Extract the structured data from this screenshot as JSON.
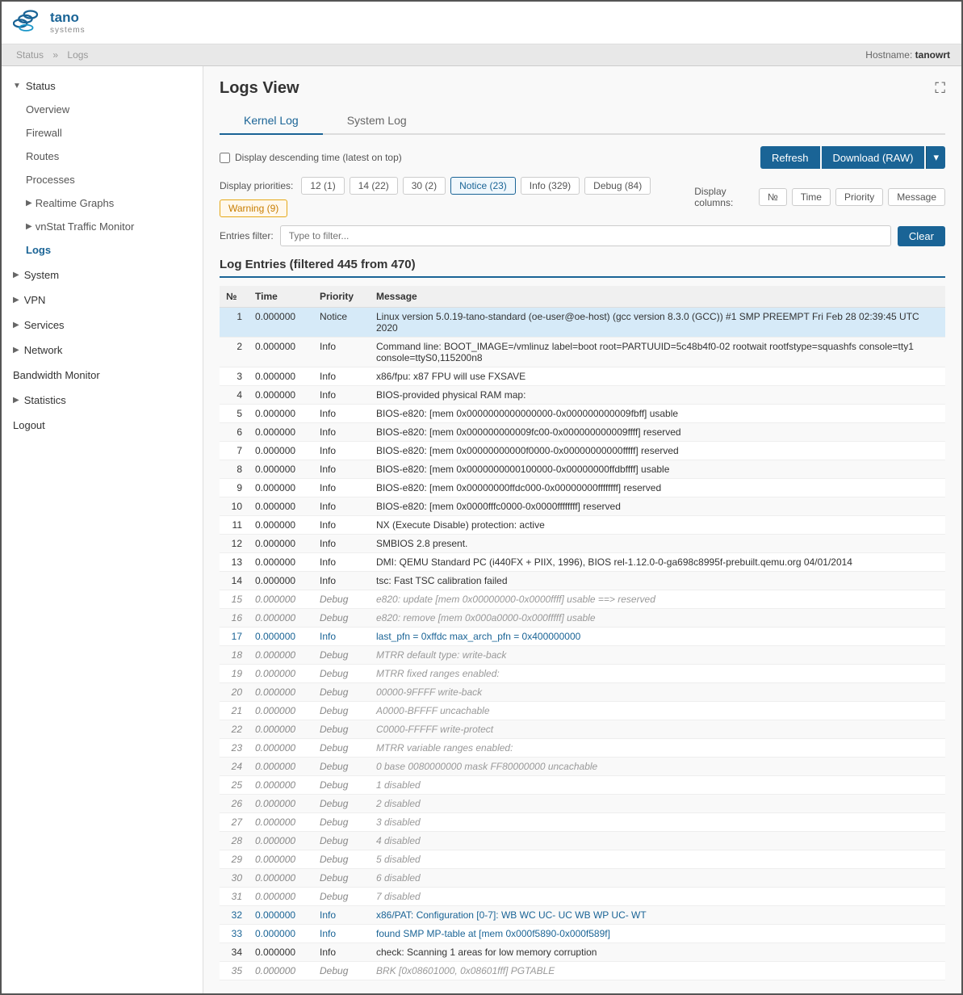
{
  "header": {
    "logo_tano": "tano",
    "logo_systems": "systems",
    "hostname_label": "Hostname:",
    "hostname_value": "tanowrt"
  },
  "breadcrumb": {
    "items": [
      "Status",
      "Logs"
    ]
  },
  "sidebar": {
    "sections": [
      {
        "label": "Status",
        "expanded": true,
        "items": [
          "Overview",
          "Firewall",
          "Routes",
          "Processes"
        ]
      }
    ],
    "collapsible_items": [
      {
        "label": "Realtime Graphs",
        "expandable": true
      },
      {
        "label": "vnStat Traffic Monitor",
        "expandable": true
      },
      {
        "label": "Logs",
        "active": true
      }
    ],
    "top_sections": [
      {
        "label": "System",
        "expandable": true
      },
      {
        "label": "VPN",
        "expandable": true
      },
      {
        "label": "Services",
        "expandable": true
      },
      {
        "label": "Network",
        "expandable": true
      },
      {
        "label": "Bandwidth Monitor",
        "expandable": false
      },
      {
        "label": "Statistics",
        "expandable": true
      },
      {
        "label": "Logout",
        "expandable": false
      }
    ]
  },
  "logs": {
    "title": "Logs View",
    "tabs": [
      {
        "label": "Kernel Log",
        "active": true
      },
      {
        "label": "System Log",
        "active": false
      }
    ],
    "checkbox_label": "Display descending time (latest on top)",
    "buttons": {
      "refresh": "Refresh",
      "download": "Download (RAW)",
      "dropdown_arrow": "▾"
    },
    "priorities_label": "Display priorities:",
    "priority_buttons": [
      {
        "label": "12 (1)",
        "type": "grey"
      },
      {
        "label": "14 (22)",
        "type": "grey"
      },
      {
        "label": "30 (2)",
        "type": "grey"
      },
      {
        "label": "Notice (23)",
        "type": "notice"
      },
      {
        "label": "Info (329)",
        "type": "info"
      },
      {
        "label": "Debug (84)",
        "type": "debug"
      },
      {
        "label": "Warning (9)",
        "type": "warning"
      }
    ],
    "columns_label": "Display columns:",
    "column_buttons": [
      "№",
      "Time",
      "Priority",
      "Message"
    ],
    "filter_label": "Entries filter:",
    "filter_placeholder": "Type to filter...",
    "clear_button": "Clear",
    "section_title": "Log Entries (filtered 445 from 470)",
    "table_headers": [
      "№",
      "Time",
      "Priority",
      "Message"
    ],
    "entries": [
      {
        "num": "1",
        "time": "0.000000",
        "priority": "Notice",
        "message": "Linux version 5.0.19-tano-standard (oe-user@oe-host) (gcc version 8.3.0 (GCC)) #1 SMP PREEMPT Fri Feb 28 02:39:45 UTC 2020",
        "style": "highlight"
      },
      {
        "num": "2",
        "time": "0.000000",
        "priority": "Info",
        "message": "Command line: BOOT_IMAGE=/vmlinuz label=boot root=PARTUUID=5c48b4f0-02 rootwait rootfstype=squashfs console=tty1 console=ttyS0,115200n8",
        "style": "normal"
      },
      {
        "num": "3",
        "time": "0.000000",
        "priority": "Info",
        "message": "x86/fpu: x87 FPU will use FXSAVE",
        "style": "normal"
      },
      {
        "num": "4",
        "time": "0.000000",
        "priority": "Info",
        "message": "BIOS-provided physical RAM map:",
        "style": "normal"
      },
      {
        "num": "5",
        "time": "0.000000",
        "priority": "Info",
        "message": "BIOS-e820: [mem 0x0000000000000000-0x000000000009fbff] usable",
        "style": "normal"
      },
      {
        "num": "6",
        "time": "0.000000",
        "priority": "Info",
        "message": "BIOS-e820: [mem 0x000000000009fc00-0x000000000009ffff] reserved",
        "style": "normal"
      },
      {
        "num": "7",
        "time": "0.000000",
        "priority": "Info",
        "message": "BIOS-e820: [mem 0x00000000000f0000-0x00000000000fffff] reserved",
        "style": "normal"
      },
      {
        "num": "8",
        "time": "0.000000",
        "priority": "Info",
        "message": "BIOS-e820: [mem 0x0000000000100000-0x00000000ffdbffff] usable",
        "style": "normal"
      },
      {
        "num": "9",
        "time": "0.000000",
        "priority": "Info",
        "message": "BIOS-e820: [mem 0x00000000ffdc000-0x00000000ffffffff] reserved",
        "style": "normal"
      },
      {
        "num": "10",
        "time": "0.000000",
        "priority": "Info",
        "message": "BIOS-e820: [mem 0x0000fffc0000-0x0000ffffffff] reserved",
        "style": "normal"
      },
      {
        "num": "11",
        "time": "0.000000",
        "priority": "Info",
        "message": "NX (Execute Disable) protection: active",
        "style": "normal"
      },
      {
        "num": "12",
        "time": "0.000000",
        "priority": "Info",
        "message": "SMBIOS 2.8 present.",
        "style": "normal"
      },
      {
        "num": "13",
        "time": "0.000000",
        "priority": "Info",
        "message": "DMI: QEMU Standard PC (i440FX + PIIX, 1996), BIOS rel-1.12.0-0-ga698c8995f-prebuilt.qemu.org 04/01/2014",
        "style": "normal"
      },
      {
        "num": "14",
        "time": "0.000000",
        "priority": "Info",
        "message": "tsc: Fast TSC calibration failed",
        "style": "normal"
      },
      {
        "num": "15",
        "time": "0.000000",
        "priority": "Debug",
        "message": "e820: update [mem 0x00000000-0x0000ffff] usable ==> reserved",
        "style": "debug"
      },
      {
        "num": "16",
        "time": "0.000000",
        "priority": "Debug",
        "message": "e820: remove [mem 0x000a0000-0x000fffff] usable",
        "style": "debug"
      },
      {
        "num": "17",
        "time": "0.000000",
        "priority": "Info",
        "message": "last_pfn = 0xffdc max_arch_pfn = 0x400000000",
        "style": "info-highlight"
      },
      {
        "num": "18",
        "time": "0.000000",
        "priority": "Debug",
        "message": "MTRR default type: write-back",
        "style": "debug"
      },
      {
        "num": "19",
        "time": "0.000000",
        "priority": "Debug",
        "message": "MTRR fixed ranges enabled:",
        "style": "debug"
      },
      {
        "num": "20",
        "time": "0.000000",
        "priority": "Debug",
        "message": "00000-9FFFF write-back",
        "style": "debug"
      },
      {
        "num": "21",
        "time": "0.000000",
        "priority": "Debug",
        "message": "A0000-BFFFF uncachable",
        "style": "debug"
      },
      {
        "num": "22",
        "time": "0.000000",
        "priority": "Debug",
        "message": "C0000-FFFFF write-protect",
        "style": "debug"
      },
      {
        "num": "23",
        "time": "0.000000",
        "priority": "Debug",
        "message": "MTRR variable ranges enabled:",
        "style": "debug"
      },
      {
        "num": "24",
        "time": "0.000000",
        "priority": "Debug",
        "message": "0 base 0080000000 mask FF80000000 uncachable",
        "style": "debug"
      },
      {
        "num": "25",
        "time": "0.000000",
        "priority": "Debug",
        "message": "1 disabled",
        "style": "debug"
      },
      {
        "num": "26",
        "time": "0.000000",
        "priority": "Debug",
        "message": "2 disabled",
        "style": "debug"
      },
      {
        "num": "27",
        "time": "0.000000",
        "priority": "Debug",
        "message": "3 disabled",
        "style": "debug"
      },
      {
        "num": "28",
        "time": "0.000000",
        "priority": "Debug",
        "message": "4 disabled",
        "style": "debug"
      },
      {
        "num": "29",
        "time": "0.000000",
        "priority": "Debug",
        "message": "5 disabled",
        "style": "debug"
      },
      {
        "num": "30",
        "time": "0.000000",
        "priority": "Debug",
        "message": "6 disabled",
        "style": "debug"
      },
      {
        "num": "31",
        "time": "0.000000",
        "priority": "Debug",
        "message": "7 disabled",
        "style": "debug"
      },
      {
        "num": "32",
        "time": "0.000000",
        "priority": "Info",
        "message": "x86/PAT: Configuration [0-7]: WB WC UC- UC WB WP UC- WT",
        "style": "info-highlight"
      },
      {
        "num": "33",
        "time": "0.000000",
        "priority": "Info",
        "message": "found SMP MP-table at [mem 0x000f5890-0x000f589f]",
        "style": "info-highlight"
      },
      {
        "num": "34",
        "time": "0.000000",
        "priority": "Info",
        "message": "check: Scanning 1 areas for low memory corruption",
        "style": "normal"
      },
      {
        "num": "35",
        "time": "0.000000",
        "priority": "Debug",
        "message": "BRK [0x08601000, 0x08601fff] PGTABLE",
        "style": "debug"
      }
    ]
  }
}
